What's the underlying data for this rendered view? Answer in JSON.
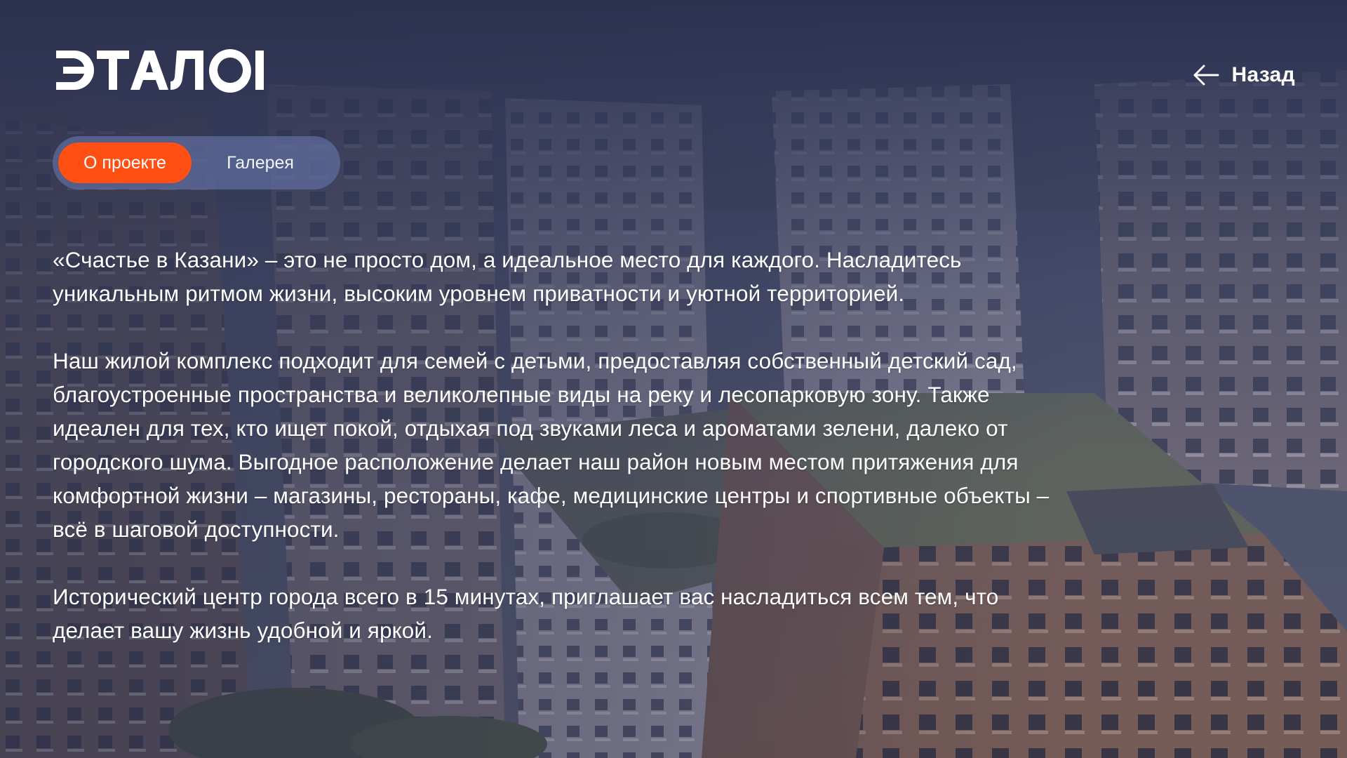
{
  "brand": {
    "logo_text": "ЭТАЛОН"
  },
  "header": {
    "back_label": "Назад",
    "back_icon": "arrow-left-icon"
  },
  "tabs": [
    {
      "label": "О проекте",
      "active": true
    },
    {
      "label": "Галерея",
      "active": false
    }
  ],
  "content": {
    "paragraphs": [
      "«Счастье в Казани» – это не просто дом, а идеальное место для каждого. Насладитесь уникальным ритмом жизни, высоким уровнем приватности и уютной территорией.",
      "Наш жилой комплекс подходит для семей с детьми, предоставляя собственный детский сад, благоустроенные пространства и великолепные виды на реку и лесопарковую зону. Также идеален для тех, кто ищет покой, отдыхая под звуками леса и ароматами зелени, далеко от городского шума. Выгодное расположение делает наш район новым местом притяжения для комфортной жизни – магазины, рестораны, кафе, медицинские центры и спортивные объекты – всё в шаговой доступности.",
      "Исторический центр города всего в 15 минутах, приглашает вас насладиться всем тем, что делает вашу жизнь удобной и яркой."
    ]
  },
  "colors": {
    "accent": "#ff4f12",
    "tabs_background": "#606ea0",
    "overlay": "#2a304e",
    "text": "#ffffff"
  }
}
